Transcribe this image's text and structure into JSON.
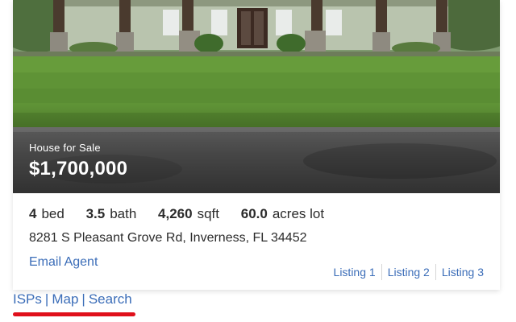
{
  "listing_card": {
    "sale_type": "House for Sale",
    "price": "$1,700,000",
    "stats": [
      {
        "value": "4",
        "unit": "bed"
      },
      {
        "value": "3.5",
        "unit": "bath"
      },
      {
        "value": "4,260",
        "unit": "sqft"
      },
      {
        "value": "60.0",
        "unit": "acres lot"
      }
    ],
    "address": "8281 S Pleasant Grove Rd, Inverness, FL 34452",
    "email_agent": "Email Agent",
    "listing_links": [
      "Listing 1",
      "Listing 2",
      "Listing 3"
    ]
  },
  "footer": {
    "links": [
      "ISPs",
      "Map",
      "Search"
    ],
    "separator": "|"
  },
  "colors": {
    "link": "#3b6db8",
    "text": "#2b2b2b",
    "annotation_underline": "#e0101b"
  }
}
